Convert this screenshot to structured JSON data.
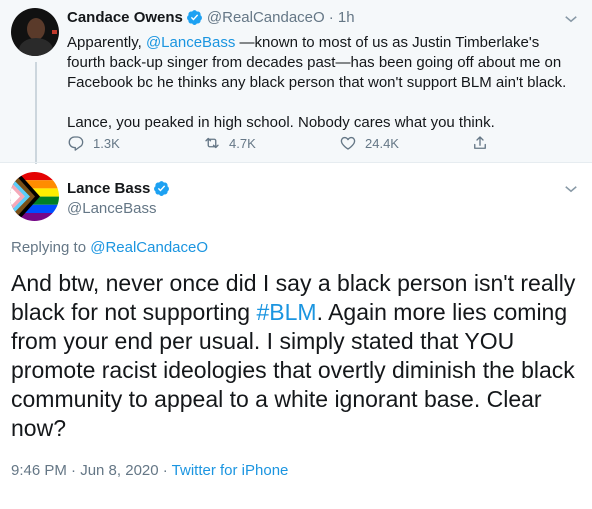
{
  "parent_tweet": {
    "author_name": "Candace Owens",
    "handle": "@RealCandaceO",
    "time": "· 1h",
    "body_pre": "Apparently, ",
    "mention": "@LanceBass",
    "body_post": " —known to most of us as Justin Timberlake's fourth back-up singer from decades past—has been going off about me on Facebook bc he thinks any black person that won't support BLM ain't black.",
    "body_2": "Lance, you peaked in high school. Nobody cares what you think.",
    "replies": "1.3K",
    "retweets": "4.7K",
    "likes": "24.4K"
  },
  "main_tweet": {
    "author_name": "Lance Bass",
    "handle": "@LanceBass",
    "replying_label": "Replying to",
    "replying_handle": "@RealCandaceO",
    "text_pre": "And btw, never once did I say a black person isn't really black for not supporting ",
    "hashtag": "#BLM",
    "text_post": ". Again more lies coming from your end per usual. I simply stated that YOU promote racist ideologies that overtly diminish the black community to appeal to a white ignorant base. Clear now?",
    "timestamp": "9:46 PM · Jun 8, 2020 · ",
    "source": "Twitter for iPhone"
  },
  "icons": {
    "verified": "verified-badge-icon",
    "reply": "reply-icon",
    "retweet": "retweet-icon",
    "like": "heart-icon",
    "share": "share-icon",
    "more": "chevron-down-icon"
  },
  "colors": {
    "link": "#1b95e0",
    "secondary_text": "#657786",
    "primary_text": "#14171a",
    "thread_bg": "#f5f8fa"
  }
}
